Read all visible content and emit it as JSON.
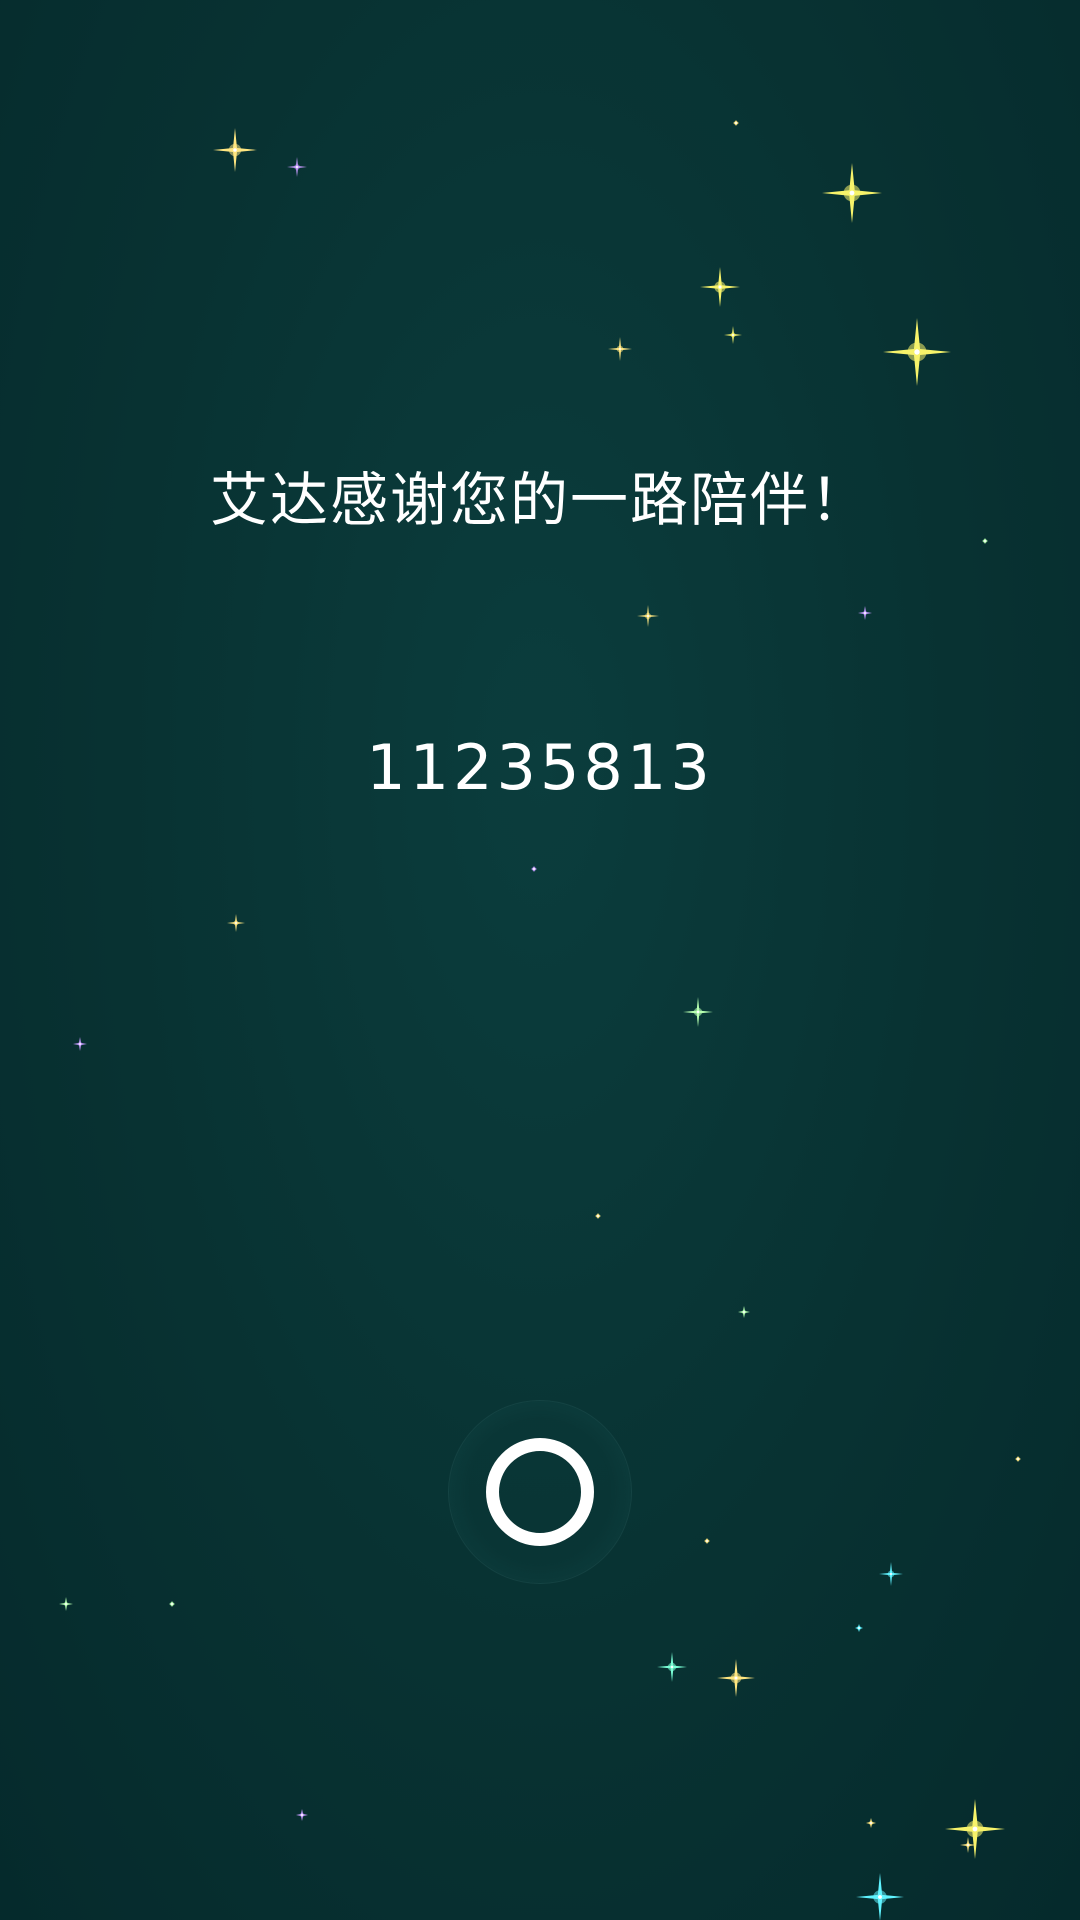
{
  "message": "艾达感谢您的一路陪伴！",
  "code": "11235813",
  "icons": {
    "ring_button": "circle-ring-icon",
    "stars": "sparkle-star-icon"
  },
  "colors": {
    "background_top": "#0b3d3d",
    "background_bottom": "#052a2c",
    "text": "#ffffff",
    "star_gold": "#ffe680",
    "star_yellow": "#f7f36a",
    "star_violet": "#c89cff",
    "star_teal": "#7affd6",
    "star_cyan": "#5ff3ff",
    "star_green": "#b6ffb0"
  }
}
